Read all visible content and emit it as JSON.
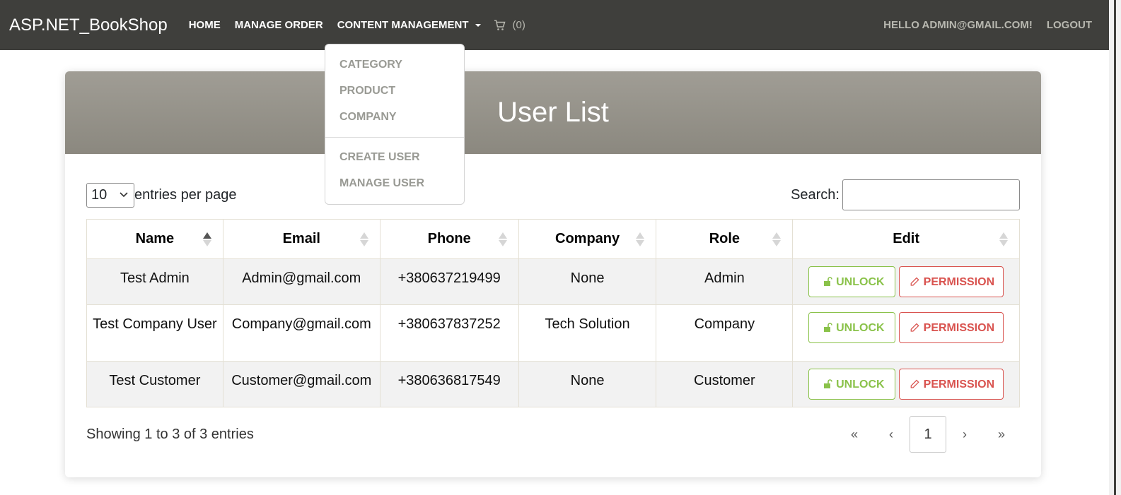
{
  "navbar": {
    "brand": "ASP.NET_BookShop",
    "links": [
      "HOME",
      "MANAGE ORDER",
      "CONTENT MANAGEMENT"
    ],
    "cart_count": "(0)",
    "greeting": "HELLO ADMIN@GMAIL.COM!",
    "logout": "LOGOUT"
  },
  "dropdown": {
    "items": [
      "CATEGORY",
      "PRODUCT",
      "COMPANY"
    ],
    "items2": [
      "CREATE USER",
      "MANAGE USER"
    ]
  },
  "page": {
    "title": "User List",
    "entries_value": "10",
    "entries_label": "entries per page",
    "search_label": "Search:",
    "search_value": "",
    "info": "Showing 1 to 3 of 3 entries"
  },
  "table": {
    "headers": [
      "Name",
      "Email",
      "Phone",
      "Company",
      "Role",
      "Edit"
    ],
    "rows": [
      {
        "name": "Test Admin",
        "email": "Admin@gmail.com",
        "phone": "+380637219499",
        "company": "None",
        "role": "Admin"
      },
      {
        "name": "Test Company User",
        "email": "Company@gmail.com",
        "phone": "+380637837252",
        "company": "Tech Solution",
        "role": "Company"
      },
      {
        "name": "Test Customer",
        "email": "Customer@gmail.com",
        "phone": "+380636817549",
        "company": "None",
        "role": "Customer"
      }
    ],
    "unlock_label": "UNLOCK",
    "permission_label": "PERMISSION"
  },
  "pager": {
    "first": "«",
    "prev": "‹",
    "current": "1",
    "next": "›",
    "last": "»"
  },
  "colors": {
    "navbar": "#3f3f3c",
    "header": "#98958c",
    "unlock": "#8ac24a",
    "permission": "#d9534f"
  },
  "icons": [
    "cart-icon",
    "unlock-icon",
    "pencil-icon",
    "chevron-down-icon",
    "sort-icon"
  ]
}
